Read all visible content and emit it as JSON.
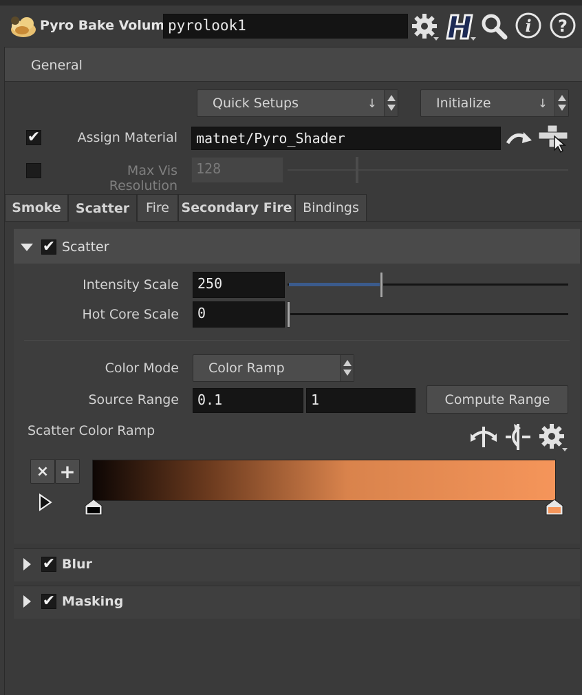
{
  "header": {
    "node_type": "Pyro Bake Volume",
    "node_name": "pyrolook1",
    "icons": [
      "gear-icon",
      "houdini-h-icon",
      "search-icon",
      "info-icon",
      "help-icon"
    ]
  },
  "folder": {
    "general_label": "General"
  },
  "general": {
    "quick_setups_label": "Quick Setups",
    "initialize_label": "Initialize",
    "assign_material": {
      "label": "Assign Material",
      "checked": true,
      "value": "matnet/Pyro_Shader"
    },
    "max_vis_resolution": {
      "label": "Max Vis Resolution",
      "checked": false,
      "value": "128"
    }
  },
  "tabs": [
    {
      "label": "Smoke",
      "bold": true
    },
    {
      "label": "Scatter",
      "bold": true,
      "active": true
    },
    {
      "label": "Fire",
      "bold": false
    },
    {
      "label": "Secondary Fire",
      "bold": true
    },
    {
      "label": "Bindings",
      "bold": false
    }
  ],
  "scatter": {
    "title": "Scatter",
    "enabled": true,
    "intensity_scale": {
      "label": "Intensity Scale",
      "value": "250",
      "slider_fraction": 0.33
    },
    "hot_core_scale": {
      "label": "Hot Core Scale",
      "value": "0",
      "slider_fraction": 0.0
    },
    "color_mode": {
      "label": "Color Mode",
      "value": "Color Ramp"
    },
    "source_range": {
      "label": "Source Range",
      "min": "0.1",
      "max": "1"
    },
    "compute_range_label": "Compute Range",
    "color_ramp": {
      "label": "Scatter Color Ramp",
      "start_color": "#0d0604",
      "end_color": "#f5955a",
      "keys": [
        {
          "position": 0.0,
          "color": "#000000"
        },
        {
          "position": 1.0,
          "color": "#f5955a"
        }
      ]
    }
  },
  "sections": [
    {
      "title": "Blur",
      "enabled": true,
      "expanded": false
    },
    {
      "title": "Masking",
      "enabled": true,
      "expanded": false
    }
  ],
  "colors": {
    "background": "#3a3a3a",
    "field_bg": "#151515",
    "slider_fill": "#3b5b8c"
  }
}
